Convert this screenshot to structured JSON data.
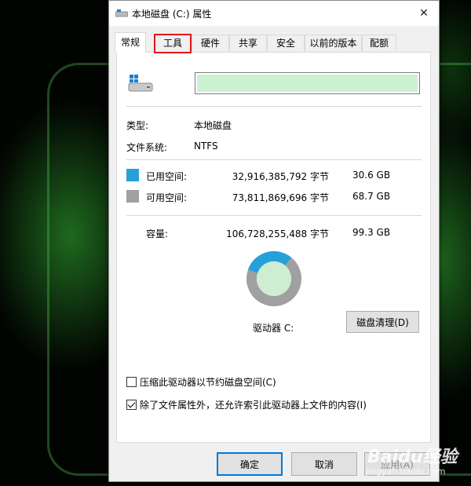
{
  "window": {
    "title": "本地磁盘 (C:) 属性",
    "close_glyph": "✕"
  },
  "tabs": [
    {
      "label": "常规",
      "active": true
    },
    {
      "label": "工具",
      "highlighted": true
    },
    {
      "label": "硬件"
    },
    {
      "label": "共享"
    },
    {
      "label": "安全"
    },
    {
      "label": "以前的版本"
    },
    {
      "label": "配额"
    }
  ],
  "general": {
    "name_value": "",
    "type_label": "类型:",
    "type_value": "本地磁盘",
    "fs_label": "文件系统:",
    "fs_value": "NTFS",
    "used": {
      "label": "已用空间:",
      "bytes": "32,916,385,792 字节",
      "size": "30.6 GB",
      "color": "#26a0da"
    },
    "free": {
      "label": "可用空间:",
      "bytes": "73,811,869,696 字节",
      "size": "68.7 GB",
      "color": "#a0a0a0"
    },
    "capacity": {
      "label": "容量:",
      "bytes": "106,728,255,488 字节",
      "size": "99.3 GB"
    },
    "drive_label": "驱动器 C:",
    "cleanup_button": "磁盘清理(D)",
    "compress_checkbox": {
      "label": "压缩此驱动器以节约磁盘空间(C)",
      "checked": false
    },
    "index_checkbox": {
      "label": "除了文件属性外，还允许索引此驱动器上文件的内容(I)",
      "checked": true
    }
  },
  "chart_data": {
    "type": "pie",
    "categories": [
      "已用空间",
      "可用空间"
    ],
    "values": [
      30.6,
      68.7
    ],
    "colors": [
      "#26a0da",
      "#a0a0a0"
    ]
  },
  "footer": {
    "ok": "确定",
    "cancel": "取消",
    "apply": "应用(A)"
  },
  "watermark": {
    "brand": "Baidu经验",
    "site": "jingyan.baidu.com"
  }
}
